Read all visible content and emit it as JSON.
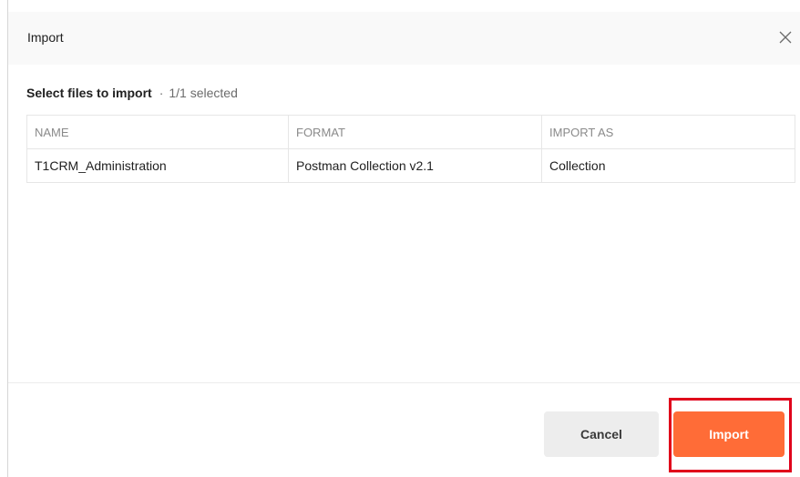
{
  "dialog": {
    "title": "Import",
    "close_icon": "close-icon"
  },
  "selection": {
    "heading": "Select files to import",
    "separator": "·",
    "count": "1/1 selected"
  },
  "table": {
    "headers": {
      "name": "NAME",
      "format": "FORMAT",
      "import_as": "IMPORT AS"
    },
    "rows": [
      {
        "name": "T1CRM_Administration",
        "format": "Postman Collection v2.1",
        "import_as": "Collection"
      }
    ]
  },
  "footer": {
    "cancel_label": "Cancel",
    "import_label": "Import"
  },
  "colors": {
    "primary_button": "#ff6c37",
    "annotation_highlight": "#e0001b"
  }
}
